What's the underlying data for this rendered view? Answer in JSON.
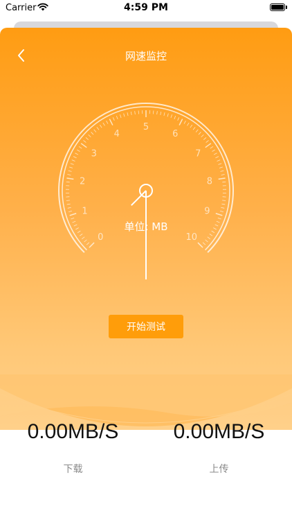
{
  "status_bar": {
    "carrier": "Carrier",
    "time": "4:59 PM",
    "icons": [
      "wifi-icon",
      "battery-icon"
    ]
  },
  "nav": {
    "title": "网速监控",
    "back_icon": "chevron-left-icon"
  },
  "gauge": {
    "ticks": [
      "0",
      "1",
      "2",
      "3",
      "4",
      "5",
      "6",
      "7",
      "8",
      "9",
      "10"
    ],
    "unit_label": "单位: MB",
    "value": 0
  },
  "actions": {
    "start_label": "开始测试"
  },
  "stats": {
    "download": {
      "value": "0.00MB/S",
      "label": "下载"
    },
    "upload": {
      "value": "0.00MB/S",
      "label": "上传"
    }
  },
  "colors": {
    "accent": "#ff9d0a",
    "gradient_top": "#ff9c12",
    "gradient_bottom": "#ffd08a"
  }
}
